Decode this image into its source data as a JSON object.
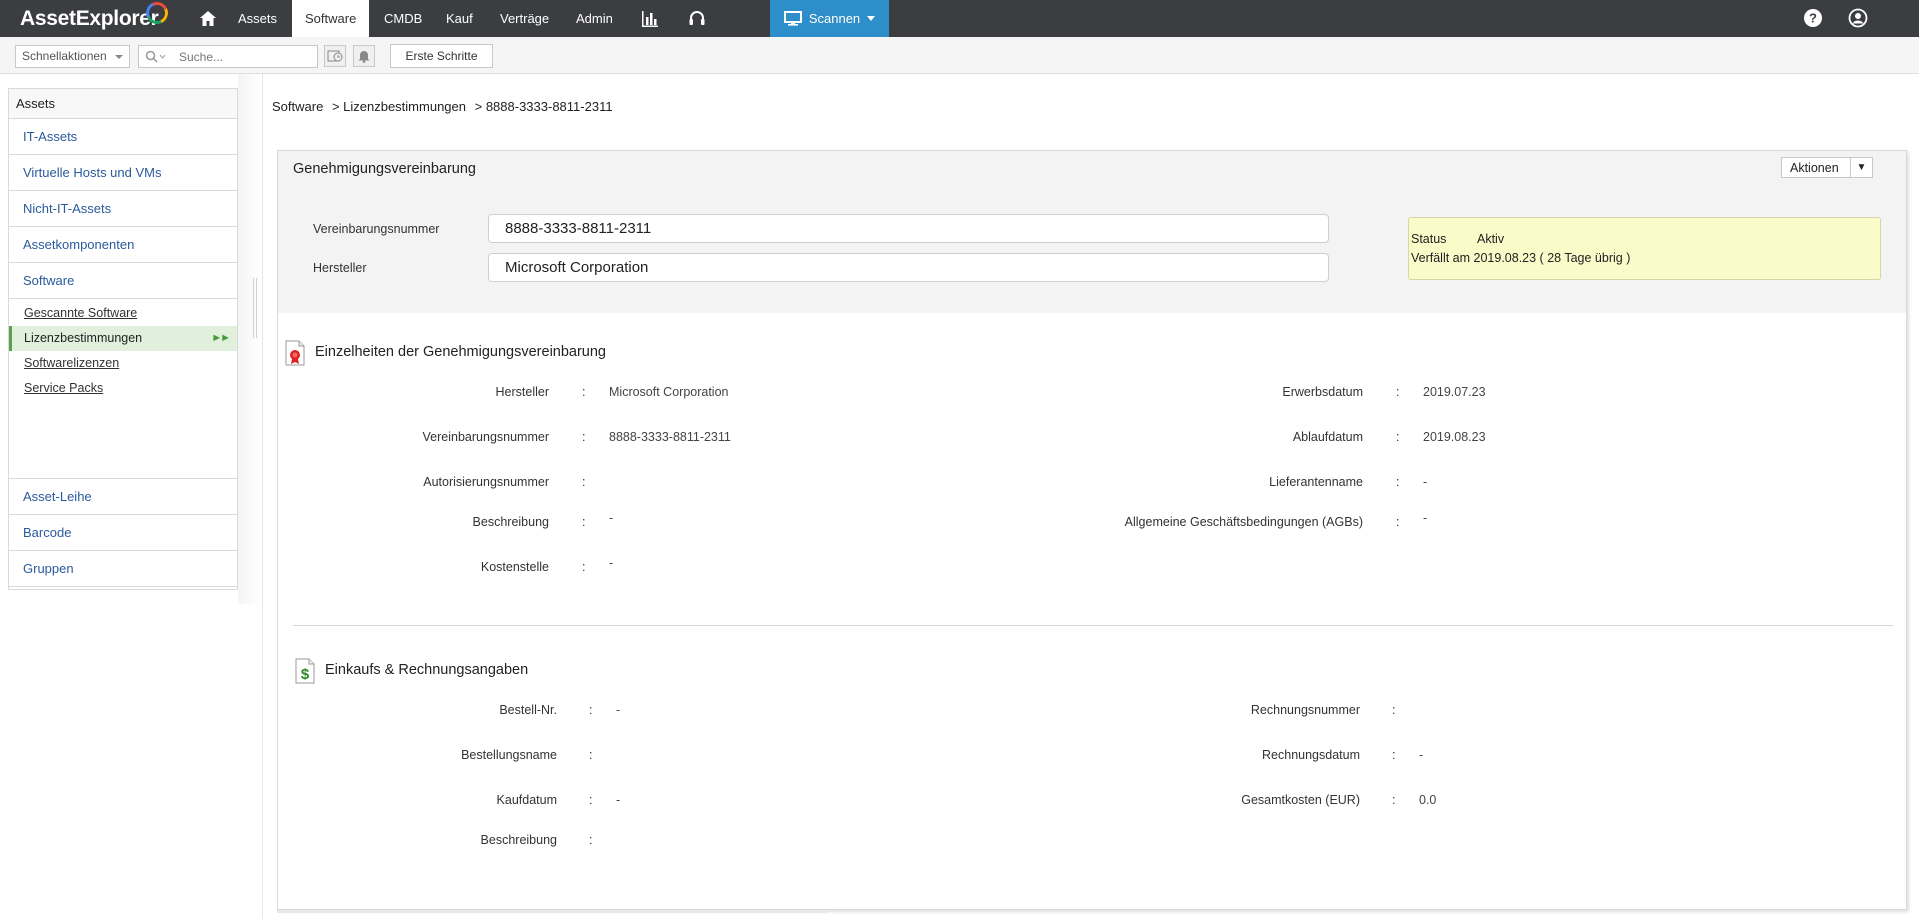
{
  "app": {
    "logo": "AssetExplorer",
    "nav": [
      {
        "label": "Assets"
      },
      {
        "label": "Software",
        "active": true
      },
      {
        "label": "CMDB"
      },
      {
        "label": "Kauf"
      },
      {
        "label": "Verträge"
      },
      {
        "label": "Admin"
      }
    ],
    "nav_icons": [
      "home-icon",
      "reports-icon",
      "support-headset-icon"
    ],
    "scan_button": "Scannen",
    "right_icons": [
      "help-icon",
      "user-profile-icon"
    ],
    "colors": {
      "topbar": "#3b3d40",
      "scan_button": "#2e8ec9",
      "active_side": "#e0f0dd",
      "status_box": "#fbfbc9"
    }
  },
  "toolbar": {
    "quick_actions": "Schnellaktionen",
    "search_placeholder": "Suche...",
    "icons": [
      "history-icon",
      "bell-icon"
    ],
    "first_steps": "Erste Schritte"
  },
  "sidebar": {
    "header": "Assets",
    "items_top": [
      "IT-Assets",
      "Virtuelle Hosts und VMs",
      "Nicht-IT-Assets",
      "Assetkomponenten",
      "Software"
    ],
    "sub_items": [
      {
        "label": "Gescannte Software"
      },
      {
        "label": "Lizenzbestimmungen",
        "active": true
      },
      {
        "label": "Softwarelizenzen"
      },
      {
        "label": "Service Packs"
      }
    ],
    "items_bottom": [
      "Asset-Leihe",
      "Barcode",
      "Gruppen"
    ]
  },
  "breadcrumb": [
    "Software",
    "> Lizenzbestimmungen",
    "> 8888-3333-8811-2311"
  ],
  "card": {
    "title": "Genehmigungsvereinbarung",
    "actions": "Aktionen",
    "form": {
      "agreement_number_label": "Vereinbarungsnummer",
      "agreement_number_value": "8888-3333-8811-2311",
      "manufacturer_label": "Hersteller",
      "manufacturer_value": "Microsoft Corporation"
    },
    "status": {
      "label": "Status",
      "value": "Aktiv",
      "expiry": "Verfällt am 2019.08.23 ( 28 Tage übrig )"
    },
    "details": {
      "title": "Einzelheiten der Genehmigungsvereinbarung",
      "left": [
        {
          "label": "Hersteller",
          "value": "Microsoft Corporation"
        },
        {
          "label": "Vereinbarungsnummer",
          "value": "8888-3333-8811-2311"
        },
        {
          "label": "Autorisierungsnummer",
          "value": ""
        },
        {
          "label": "Beschreibung",
          "value": "-"
        },
        {
          "label": "Kostenstelle",
          "value": "-"
        }
      ],
      "right": [
        {
          "label": "Erwerbsdatum",
          "value": "2019.07.23"
        },
        {
          "label": "Ablaufdatum",
          "value": "2019.08.23"
        },
        {
          "label": "Lieferantenname",
          "value": "-"
        },
        {
          "label": "Allgemeine Geschäftsbedingungen (AGBs)",
          "value": "-"
        }
      ]
    },
    "purchase": {
      "title": "Einkaufs & Rechnungsangaben",
      "left": [
        {
          "label": "Bestell-Nr.",
          "value": "-"
        },
        {
          "label": "Bestellungsname",
          "value": ""
        },
        {
          "label": "Kaufdatum",
          "value": "-"
        },
        {
          "label": "Beschreibung",
          "value": ""
        }
      ],
      "right": [
        {
          "label": "Rechnungsnummer",
          "value": ""
        },
        {
          "label": "Rechnungsdatum",
          "value": "-"
        },
        {
          "label": "Gesamtkosten (EUR)",
          "value": "0.0"
        }
      ]
    }
  }
}
